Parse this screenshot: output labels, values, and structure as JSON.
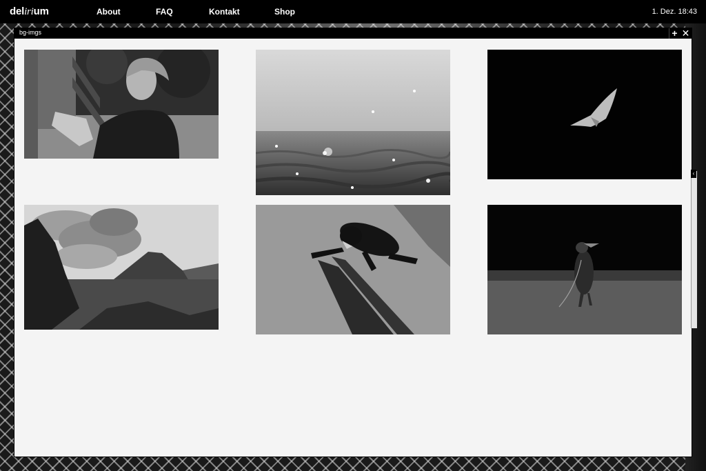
{
  "menubar": {
    "logo_pre": "del",
    "logo_mid": "iri",
    "logo_post": "um",
    "nav": [
      "About",
      "FAQ",
      "Kontakt",
      "Shop"
    ],
    "clock": "1. Dez. 18:43"
  },
  "window": {
    "title": "bg-imgs",
    "plus_label": "+",
    "close_label": "✕"
  },
  "colors": {
    "menubar_bg": "#000000",
    "window_bg": "#f4f4f4"
  }
}
